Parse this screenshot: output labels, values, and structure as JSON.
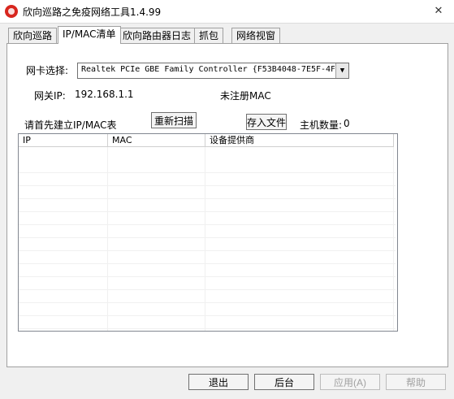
{
  "window": {
    "title": "欣向巡路之免疫网络工具1.4.99",
    "close_glyph": "✕"
  },
  "tabs": [
    {
      "label": "欣向巡路",
      "active": false
    },
    {
      "label": "IP/MAC清单",
      "active": true
    },
    {
      "label": "欣向路由器日志",
      "active": false
    },
    {
      "label": "抓包",
      "active": false
    },
    {
      "label": "网络视窗",
      "active": false
    }
  ],
  "nic": {
    "label": "网卡选择:",
    "selected": "Realtek PCIe GBE Family Controller {F53B4048-7E5F-4F"
  },
  "gateway": {
    "label": "网关IP:",
    "ip": "192.168.1.1",
    "mac_status": "未注册MAC"
  },
  "actions": {
    "hint": "请首先建立IP/MAC表",
    "rescan": "重新扫描",
    "save_file": "存入文件",
    "host_count_label": "主机数量:",
    "host_count": "0"
  },
  "table": {
    "columns": [
      "IP",
      "MAC",
      "设备提供商"
    ],
    "rows": []
  },
  "footer": {
    "exit": "退出",
    "background": "后台",
    "apply": "应用(A)",
    "help": "帮助"
  }
}
